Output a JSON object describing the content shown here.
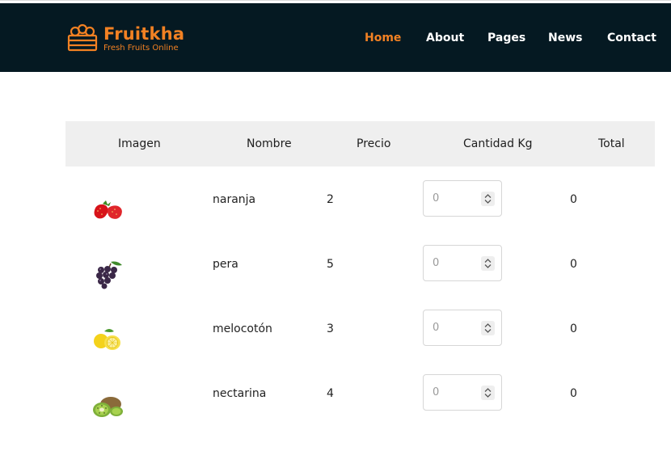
{
  "brand": {
    "name": "Fruitkha",
    "tagline": "Fresh Fruits Online"
  },
  "nav": {
    "items": [
      {
        "label": "Home",
        "active": true
      },
      {
        "label": "About",
        "active": false
      },
      {
        "label": "Pages",
        "active": false
      },
      {
        "label": "News",
        "active": false
      },
      {
        "label": "Contact",
        "active": false
      }
    ]
  },
  "colors": {
    "accent": "#F28123",
    "navbar": "#051922",
    "header_bg": "#efefef"
  },
  "table": {
    "headers": [
      "Imagen",
      "Nombre",
      "Precio",
      "Cantidad Kg",
      "Total"
    ],
    "rows": [
      {
        "image": "strawberry-icon",
        "name": "naranja",
        "price": "2",
        "qty_placeholder": "0",
        "total": "0"
      },
      {
        "image": "grapes-icon",
        "name": "pera",
        "price": "5",
        "qty_placeholder": "0",
        "total": "0"
      },
      {
        "image": "lemon-icon",
        "name": "melocotón",
        "price": "3",
        "qty_placeholder": "0",
        "total": "0"
      },
      {
        "image": "kiwi-icon",
        "name": "nectarina",
        "price": "4",
        "qty_placeholder": "0",
        "total": "0"
      }
    ]
  }
}
